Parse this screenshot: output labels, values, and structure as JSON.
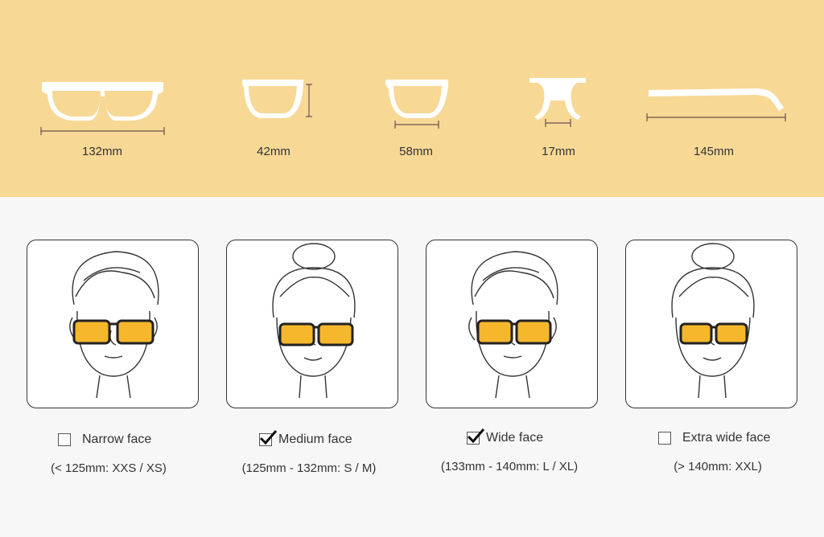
{
  "measurements": [
    {
      "value": "132mm",
      "icon": "frame-width-icon"
    },
    {
      "value": "42mm",
      "icon": "lens-height-icon"
    },
    {
      "value": "58mm",
      "icon": "lens-width-icon"
    },
    {
      "value": "17mm",
      "icon": "bridge-width-icon"
    },
    {
      "value": "145mm",
      "icon": "temple-length-icon"
    }
  ],
  "faces": [
    {
      "label": "Narrow face",
      "range": "(< 125mm: XXS / XS)",
      "checked": false,
      "gender": "male"
    },
    {
      "label": "Medium face",
      "range": "(125mm - 132mm: S / M)",
      "checked": true,
      "gender": "female"
    },
    {
      "label": "Wide face",
      "range": "(133mm - 140mm: L / XL)",
      "checked": true,
      "gender": "male"
    },
    {
      "label": "Extra wide face",
      "range": "(> 140mm: XXL)",
      "checked": false,
      "gender": "female"
    }
  ],
  "colors": {
    "banner": "#f7d895",
    "lens": "#f5b72c",
    "line": "#333333"
  }
}
